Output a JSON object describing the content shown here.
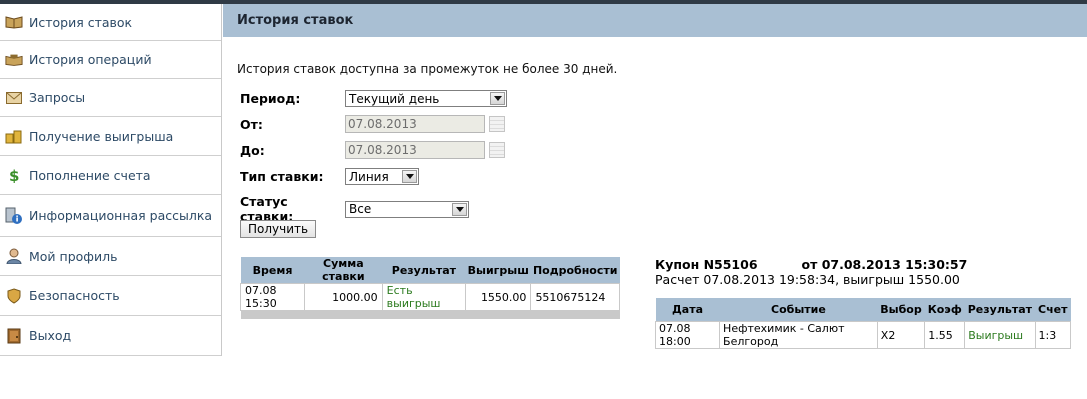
{
  "sidebar": {
    "items": [
      {
        "label": "История ставок",
        "icon": "book-icon"
      },
      {
        "label": "История операций",
        "icon": "books-icon"
      },
      {
        "label": "Запросы",
        "icon": "envelope-icon"
      },
      {
        "label": "Получение выигрыша",
        "icon": "coins-icon"
      },
      {
        "label": "Пополнение счета",
        "icon": "dollar-icon"
      },
      {
        "label": "Информационная рассылка",
        "icon": "info-icon"
      },
      {
        "label": "Мой профиль",
        "icon": "user-icon"
      },
      {
        "label": "Безопасность",
        "icon": "shield-icon"
      },
      {
        "label": "Выход",
        "icon": "door-icon"
      }
    ]
  },
  "main": {
    "title": "История ставок",
    "info": "История ставок доступна за промежуток не более 30 дней."
  },
  "form": {
    "period_label": "Период:",
    "period_value": "Текущий день",
    "from_label": "От:",
    "from_value": "07.08.2013",
    "to_label": "До:",
    "to_value": "07.08.2013",
    "bet_type_label": "Тип ставки:",
    "bet_type_value": "Линия",
    "bet_status_label": "Статус ставки:",
    "bet_status_value": "Все",
    "submit_label": "Получить"
  },
  "bets_table": {
    "headers": [
      "Время",
      "Сумма ставки",
      "Результат",
      "Выигрыш",
      "Подробности"
    ],
    "rows": [
      {
        "time": "07.08 15:30",
        "amount": "1000.00",
        "result": "Есть выигрыш",
        "win": "1550.00",
        "details": "5510675124"
      }
    ]
  },
  "coupon": {
    "number": "Купон N55106",
    "date": "от 07.08.2013 15:30:57",
    "settlement": "Расчет 07.08.2013 19:58:34, выигрыш 1550.00",
    "headers": [
      "Дата",
      "Событие",
      "Выбор",
      "Коэф",
      "Результат",
      "Счет"
    ],
    "rows": [
      {
        "date": "07.08 18:00",
        "event": "Нефтехимик - Салют Белгород",
        "choice": "X2",
        "coef": "1.55",
        "result": "Выигрыш",
        "score": "1:3"
      }
    ]
  },
  "colors": {
    "accent": "#a9bfd3",
    "link": "#2d4a66",
    "win": "#2b7a1e"
  }
}
